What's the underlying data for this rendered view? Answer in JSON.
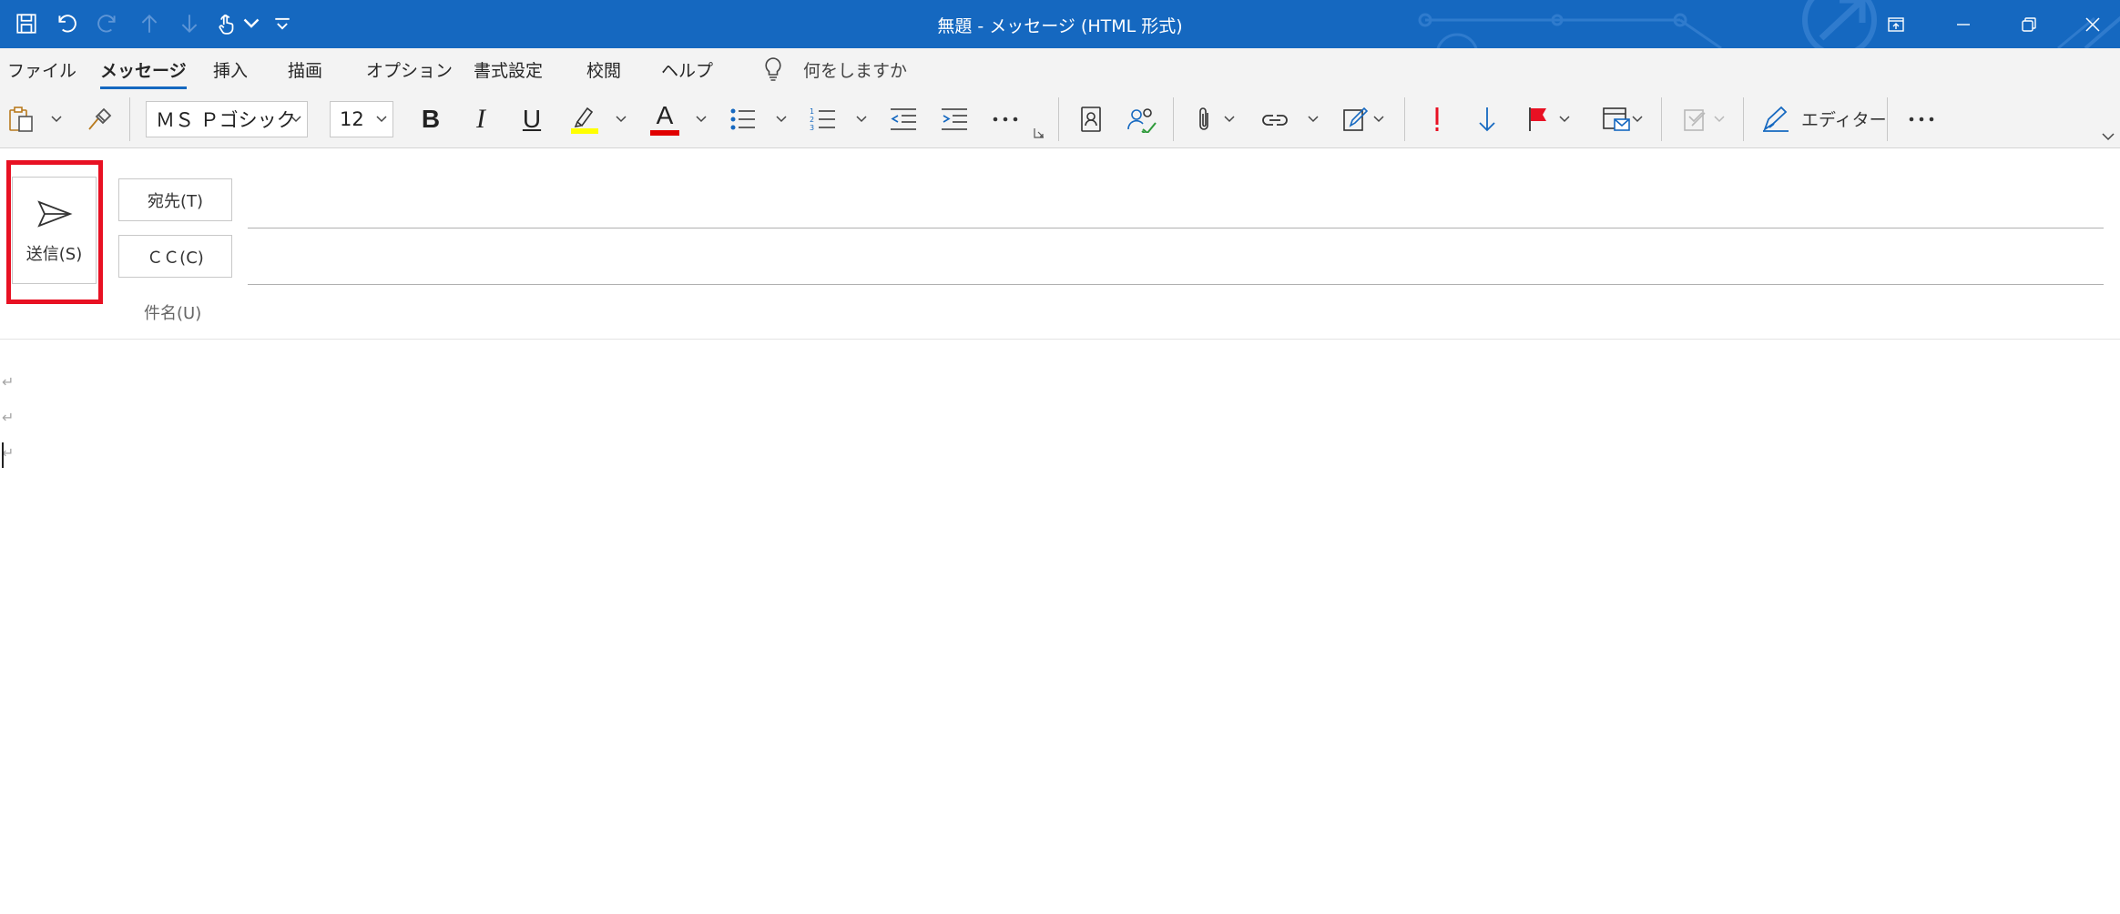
{
  "window": {
    "title": "無題  -  メッセージ (HTML 形式)"
  },
  "quick_access": {
    "items": [
      "save-icon",
      "undo-icon",
      "redo-icon",
      "previous-item-icon",
      "next-item-icon",
      "touch-mode-icon",
      "customize-qat-icon"
    ]
  },
  "window_controls": [
    "ribbon-display-options-icon",
    "minimize-icon",
    "restore-icon",
    "close-icon"
  ],
  "ribbon_tabs": {
    "file": "ファイル",
    "message": "メッセージ",
    "insert": "挿入",
    "draw": "描画",
    "options": "オプション",
    "format": "書式設定",
    "review": "校閲",
    "help": "ヘルプ",
    "active": "メッセージ"
  },
  "tell_me": {
    "text": "何をしますか"
  },
  "toolbar": {
    "font_name": "ＭＳ Ｐゴシック",
    "font_size": "12",
    "bold": "B",
    "italic": "I",
    "underline": "U",
    "font_color_letter": "A",
    "editor_label": "エディター",
    "highlight_color": "#ffff00",
    "font_color": "#e00000"
  },
  "compose": {
    "send_label": "送信(S)",
    "to_label": "宛先(T)",
    "cc_label": "ＣＣ(C)",
    "subject_label": "件名(U)",
    "paragraph_mark": "↵"
  },
  "colors": {
    "titlebar": "#1568c0",
    "highlight_box": "#e81123",
    "ribbon_bg": "#f3f3f3"
  }
}
